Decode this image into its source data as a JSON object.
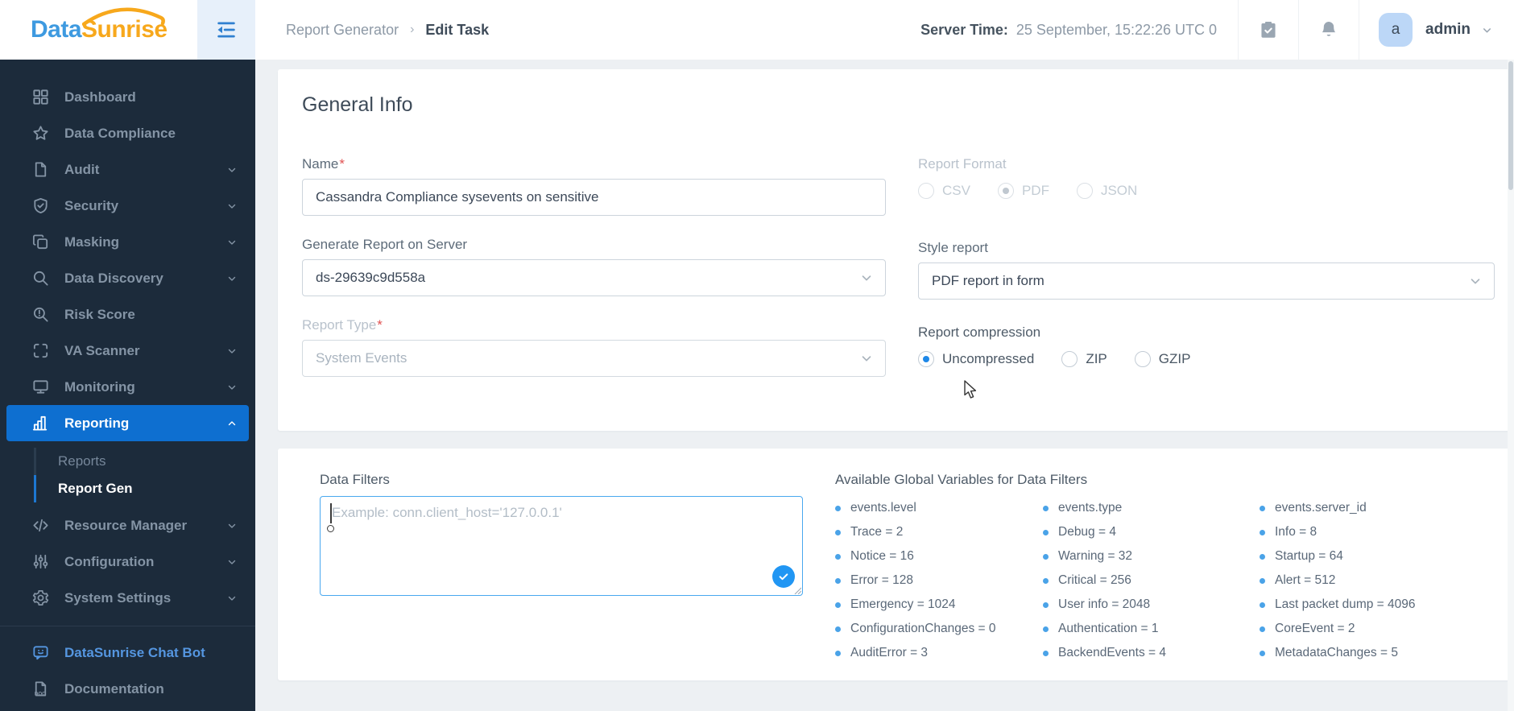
{
  "logo": {
    "part1": "Data",
    "part2": "Sunrise"
  },
  "header": {
    "breadcrumb_root": "Report Generator",
    "breadcrumb_sep": "›",
    "breadcrumb_current": "Edit Task",
    "server_time_label": "Server Time:",
    "server_time_value": "25 September, 15:22:26  UTC 0",
    "user": {
      "avatar_letter": "a",
      "name": "admin"
    }
  },
  "sidebar": {
    "items": [
      {
        "label": "Dashboard"
      },
      {
        "label": "Data Compliance"
      },
      {
        "label": "Audit"
      },
      {
        "label": "Security"
      },
      {
        "label": "Masking"
      },
      {
        "label": "Data Discovery"
      },
      {
        "label": "Risk Score"
      },
      {
        "label": "VA Scanner"
      },
      {
        "label": "Monitoring"
      },
      {
        "label": "Reporting"
      },
      {
        "label": "Resource Manager"
      },
      {
        "label": "Configuration"
      },
      {
        "label": "System Settings"
      }
    ],
    "submenu": [
      {
        "label": "Reports"
      },
      {
        "label": "Report Gen"
      }
    ],
    "chatbot_label": "DataSunrise Chat Bot",
    "documentation_label": "Documentation"
  },
  "general_info": {
    "title": "General Info",
    "required_mark": "*",
    "name": {
      "label": "Name",
      "value": "Cassandra Compliance sysevents on sensitive"
    },
    "server": {
      "label": "Generate Report on Server",
      "value": "ds-29639c9d558a"
    },
    "report_type": {
      "label": "Report Type",
      "value": "System Events"
    },
    "report_format": {
      "label": "Report Format",
      "options": [
        "CSV",
        "PDF",
        "JSON"
      ],
      "selected": "PDF"
    },
    "style_report": {
      "label": "Style report",
      "value": "PDF report in form"
    },
    "compression": {
      "label": "Report compression",
      "options": [
        "Uncompressed",
        "ZIP",
        "GZIP"
      ],
      "selected": "Uncompressed"
    }
  },
  "data_filters": {
    "label": "Data Filters",
    "placeholder": "Example: conn.client_host='127.0.0.1'"
  },
  "variables": {
    "title": "Available Global Variables for Data Filters",
    "columns": [
      [
        "events.level",
        "Trace = 2",
        "Notice = 16",
        "Error = 128",
        "Emergency = 1024",
        "ConfigurationChanges = 0",
        "AuditError = 3"
      ],
      [
        "events.type",
        "Debug = 4",
        "Warning = 32",
        "Critical = 256",
        "User info = 2048",
        "Authentication = 1",
        "BackendEvents = 4"
      ],
      [
        "events.server_id",
        "Info = 8",
        "Startup = 64",
        "Alert = 512",
        "Last packet dump = 4096",
        "CoreEvent = 2",
        "MetadataChanges = 5"
      ]
    ]
  },
  "colors": {
    "accent": "#0e6fd0",
    "radio": "#1e88e8",
    "bullet": "#4aa3e8",
    "ta-border": "#49a8ef",
    "logo-blue": "#3e9ae0",
    "logo-orange": "#f7a81c",
    "chatbot": "#5596e0",
    "check-btn": "#2196f3"
  }
}
